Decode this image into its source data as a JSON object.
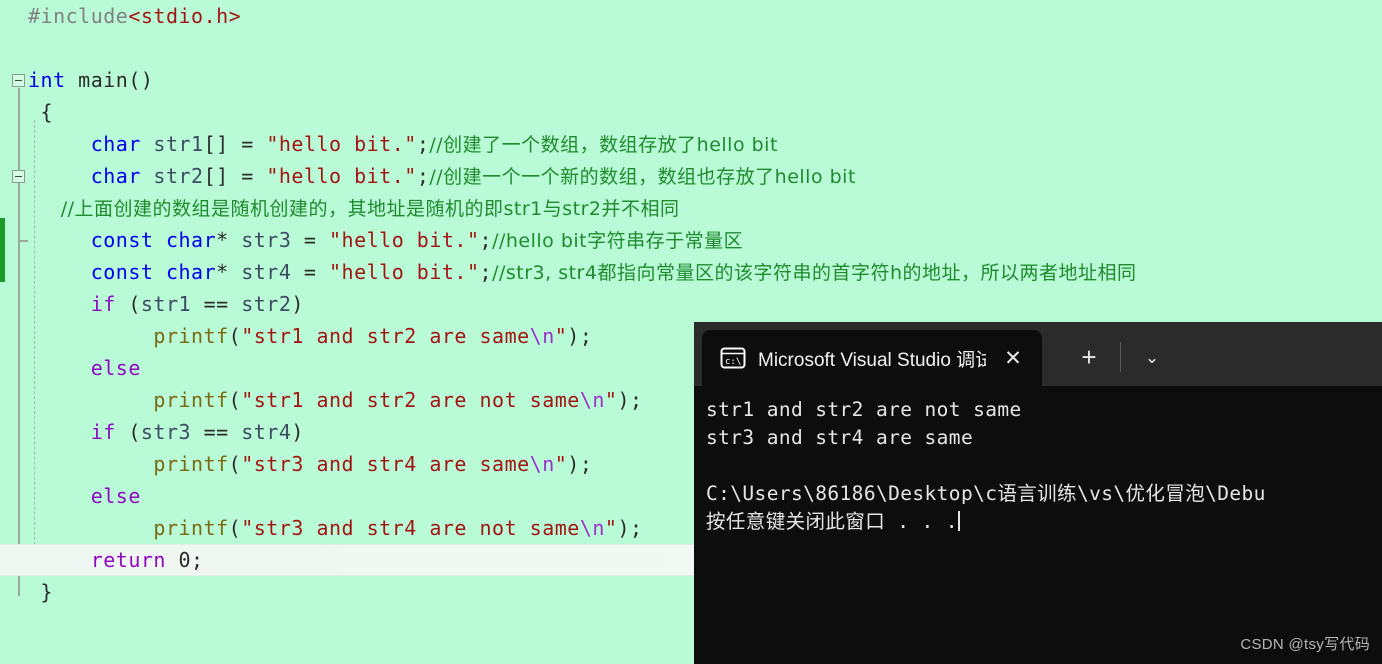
{
  "editor": {
    "background_color": "#b9fbd6",
    "change_bar_color": "#1a9a26",
    "lines": [
      {
        "indent": 1,
        "current": false,
        "tokens": [
          {
            "c": "t-pre",
            "t": "#include"
          },
          {
            "c": "t-inc",
            "t": "<stdio.h>"
          }
        ]
      },
      {
        "indent": 0,
        "current": false,
        "tokens": []
      },
      {
        "indent": 0,
        "current": false,
        "fold": true,
        "tokens": [
          {
            "c": "t-kw",
            "t": "int"
          },
          {
            "c": "t-id",
            "t": " main"
          },
          {
            "c": "t-punc",
            "t": "()"
          }
        ]
      },
      {
        "indent": 0,
        "current": false,
        "tokens": [
          {
            "c": "t-punc",
            "t": " {"
          }
        ]
      },
      {
        "indent": 0,
        "current": false,
        "tokens": [
          {
            "c": "t-kw",
            "t": "     char"
          },
          {
            "c": "t-var",
            "t": " str1"
          },
          {
            "c": "t-punc",
            "t": "[] = "
          },
          {
            "c": "t-str",
            "t": "\"hello bit.\""
          },
          {
            "c": "t-punc",
            "t": ";"
          },
          {
            "c": "t-cmt t-cjk",
            "t": "//创建了一个数组，数组存放了hello bit"
          }
        ]
      },
      {
        "indent": 0,
        "current": false,
        "fold": true,
        "tokens": [
          {
            "c": "t-kw",
            "t": "     char"
          },
          {
            "c": "t-var",
            "t": " str2"
          },
          {
            "c": "t-punc",
            "t": "[] = "
          },
          {
            "c": "t-str",
            "t": "\"hello bit.\""
          },
          {
            "c": "t-punc",
            "t": ";"
          },
          {
            "c": "t-cmt t-cjk",
            "t": "//创建一个一个新的数组，数组也存放了hello bit"
          }
        ]
      },
      {
        "indent": 0,
        "current": false,
        "tokens": [
          {
            "c": "t-cmt t-cjk",
            "t": "     //上面创建的数组是随机创建的，其地址是随机的即str1与str2并不相同"
          }
        ]
      },
      {
        "indent": 0,
        "current": false,
        "tokens": [
          {
            "c": "t-kw",
            "t": "     const char"
          },
          {
            "c": "t-punc",
            "t": "* "
          },
          {
            "c": "t-var",
            "t": "str3"
          },
          {
            "c": "t-punc",
            "t": " = "
          },
          {
            "c": "t-str",
            "t": "\"hello bit.\""
          },
          {
            "c": "t-punc",
            "t": ";"
          },
          {
            "c": "t-cmt t-cjk",
            "t": "//hello bit字符串存于常量区"
          }
        ]
      },
      {
        "indent": 0,
        "current": false,
        "tokens": [
          {
            "c": "t-kw",
            "t": "     const char"
          },
          {
            "c": "t-punc",
            "t": "* "
          },
          {
            "c": "t-var",
            "t": "str4"
          },
          {
            "c": "t-punc",
            "t": " = "
          },
          {
            "c": "t-str",
            "t": "\"hello bit.\""
          },
          {
            "c": "t-punc",
            "t": ";"
          },
          {
            "c": "t-cmt t-cjk",
            "t": "//str3, str4都指向常量区的该字符串的首字符h的地址，所以两者地址相同"
          }
        ]
      },
      {
        "indent": 0,
        "current": false,
        "tokens": [
          {
            "c": "t-ctl",
            "t": "     if"
          },
          {
            "c": "t-punc",
            "t": " ("
          },
          {
            "c": "t-var",
            "t": "str1"
          },
          {
            "c": "t-punc",
            "t": " == "
          },
          {
            "c": "t-var",
            "t": "str2"
          },
          {
            "c": "t-punc",
            "t": ")"
          }
        ]
      },
      {
        "indent": 0,
        "current": false,
        "tokens": [
          {
            "c": "t-fn",
            "t": "          printf"
          },
          {
            "c": "t-punc",
            "t": "("
          },
          {
            "c": "t-str",
            "t": "\"str1 and str2 are same"
          },
          {
            "c": "t-esc",
            "t": "\\n"
          },
          {
            "c": "t-str",
            "t": "\""
          },
          {
            "c": "t-punc",
            "t": ");"
          }
        ]
      },
      {
        "indent": 0,
        "current": false,
        "tokens": [
          {
            "c": "t-ctl",
            "t": "     else"
          }
        ]
      },
      {
        "indent": 0,
        "current": false,
        "tokens": [
          {
            "c": "t-fn",
            "t": "          printf"
          },
          {
            "c": "t-punc",
            "t": "("
          },
          {
            "c": "t-str",
            "t": "\"str1 and str2 are not same"
          },
          {
            "c": "t-esc",
            "t": "\\n"
          },
          {
            "c": "t-str",
            "t": "\""
          },
          {
            "c": "t-punc",
            "t": ");"
          }
        ]
      },
      {
        "indent": 0,
        "current": false,
        "tokens": [
          {
            "c": "t-ctl",
            "t": "     if"
          },
          {
            "c": "t-punc",
            "t": " ("
          },
          {
            "c": "t-var",
            "t": "str3"
          },
          {
            "c": "t-punc",
            "t": " == "
          },
          {
            "c": "t-var",
            "t": "str4"
          },
          {
            "c": "t-punc",
            "t": ")"
          }
        ]
      },
      {
        "indent": 0,
        "current": false,
        "tokens": [
          {
            "c": "t-fn",
            "t": "          printf"
          },
          {
            "c": "t-punc",
            "t": "("
          },
          {
            "c": "t-str",
            "t": "\"str3 and str4 are same"
          },
          {
            "c": "t-esc",
            "t": "\\n"
          },
          {
            "c": "t-str",
            "t": "\""
          },
          {
            "c": "t-punc",
            "t": ");"
          }
        ]
      },
      {
        "indent": 0,
        "current": false,
        "tokens": [
          {
            "c": "t-ctl",
            "t": "     else"
          }
        ]
      },
      {
        "indent": 0,
        "current": false,
        "tokens": [
          {
            "c": "t-fn",
            "t": "          printf"
          },
          {
            "c": "t-punc",
            "t": "("
          },
          {
            "c": "t-str",
            "t": "\"str3 and str4 are not same"
          },
          {
            "c": "t-esc",
            "t": "\\n"
          },
          {
            "c": "t-str",
            "t": "\""
          },
          {
            "c": "t-punc",
            "t": ");"
          }
        ]
      },
      {
        "indent": 0,
        "current": true,
        "tokens": [
          {
            "c": "t-ctl",
            "t": "     return"
          },
          {
            "c": "t-num",
            "t": " 0"
          },
          {
            "c": "t-punc",
            "t": ";"
          }
        ]
      },
      {
        "indent": 0,
        "current": false,
        "tokens": [
          {
            "c": "t-punc",
            "t": " }"
          }
        ]
      }
    ]
  },
  "console": {
    "titlebar_color": "#2b2b2b",
    "body_color": "#0d0d0d",
    "tab": {
      "icon": "console-cmd-icon",
      "title": "Microsoft Visual Studio 调试控",
      "close_label": "✕"
    },
    "new_tab_label": "+",
    "dropdown_label": "⌄",
    "output": [
      "str1 and str2 are not same",
      "str3 and str4 are same",
      "",
      "C:\\Users\\86186\\Desktop\\c语言训练\\vs\\优化冒泡\\Debu",
      "按任意键关闭此窗口 . . ."
    ]
  },
  "watermark": "CSDN @tsy写代码"
}
